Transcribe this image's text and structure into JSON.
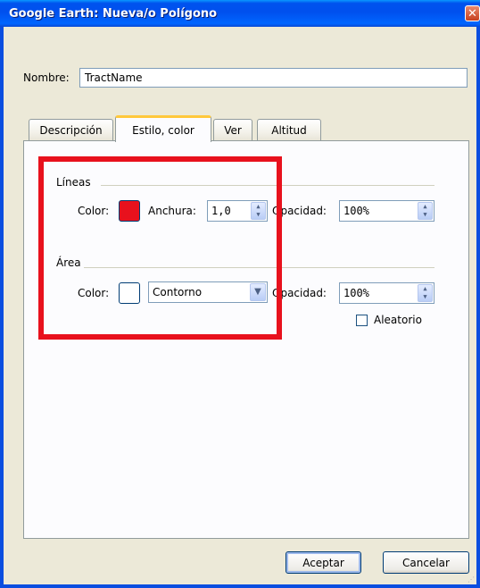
{
  "window": {
    "title": "Google Earth: Nueva/o Polígono",
    "close_icon": "close-icon"
  },
  "name_field": {
    "label": "Nombre:",
    "value": "TractName"
  },
  "tabs": [
    {
      "label": "Descripción",
      "active": false
    },
    {
      "label": "Estilo, color",
      "active": true
    },
    {
      "label": "Ver",
      "active": false
    },
    {
      "label": "Altitud",
      "active": false
    }
  ],
  "lines": {
    "title": "Líneas",
    "color_label": "Color:",
    "color_value": "#e8111d",
    "width_label": "Anchura:",
    "width_value": "1,0",
    "opacity_label": "Opacidad:",
    "opacity_value": "100%"
  },
  "area": {
    "title": "Área",
    "color_label": "Color:",
    "color_value": "#ffffff",
    "fill_mode": "Contorno",
    "opacity_label": "Opacidad:",
    "opacity_value": "100%",
    "random_label": "Aleatorio",
    "random_checked": false
  },
  "buttons": {
    "ok": "Aceptar",
    "cancel": "Cancelar"
  },
  "colors": {
    "highlight_frame": "#e8111d",
    "titlebar": "#0053ee"
  }
}
